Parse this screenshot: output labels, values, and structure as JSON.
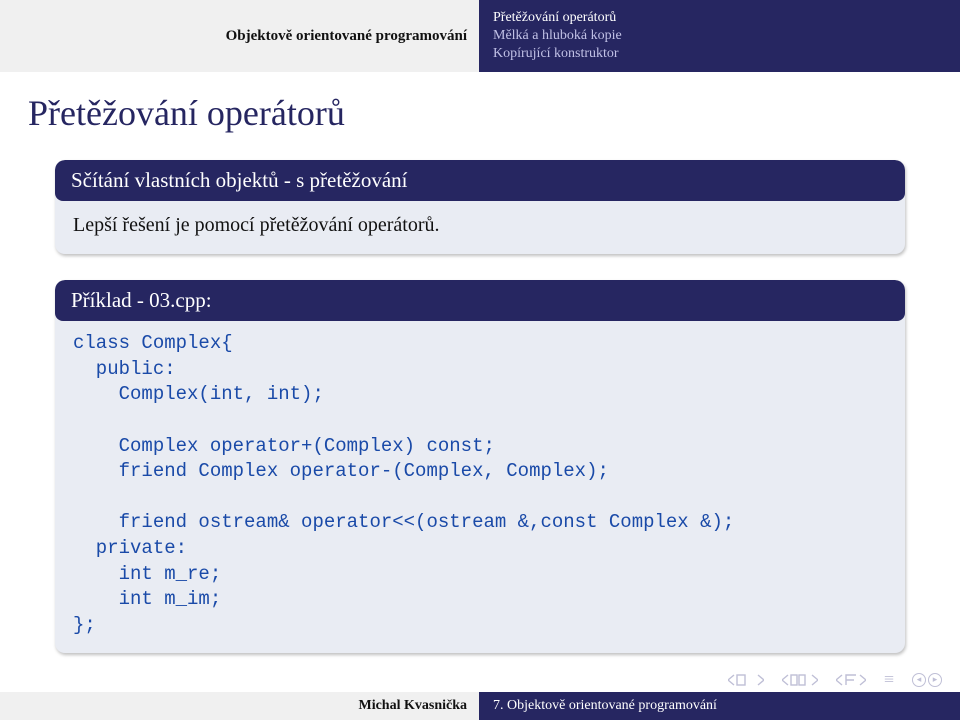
{
  "header": {
    "left": "Objektově orientované programování",
    "sections": [
      "Přetěžování operátorů",
      "Mělká a hluboká kopie",
      "Kopírující konstruktor"
    ],
    "active_section": 0
  },
  "title": "Přetěžování operátorů",
  "blocks": [
    {
      "head": "Sčítání vlastních objektů - s přetěžování",
      "body": "Lepší řešení je pomocí přetěžování operátorů."
    },
    {
      "head": "Příklad - 03.cpp:",
      "code": "class Complex{\n  public:\n    Complex(int, int);\n\n    Complex operator+(Complex) const;\n    friend Complex operator-(Complex, Complex);\n\n    friend ostream& operator<<(ostream &,const Complex &);\n  private:\n    int m_re;\n    int m_im;\n};"
    }
  ],
  "footer": {
    "author": "Michal Kvasnička",
    "talk": "7. Objektově orientované programování"
  }
}
